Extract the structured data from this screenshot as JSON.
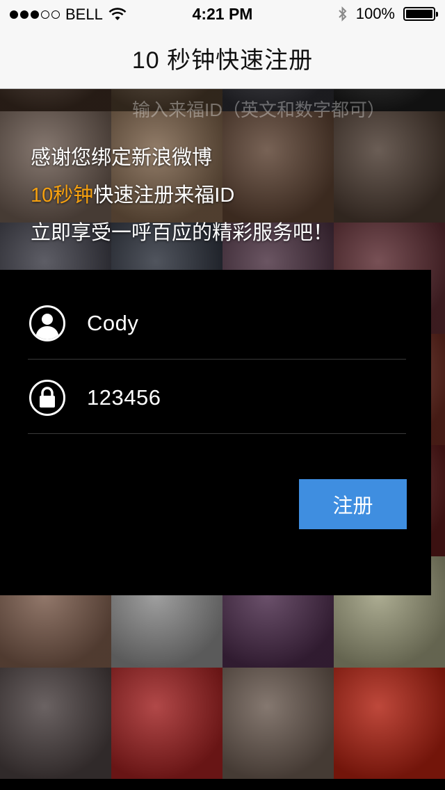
{
  "status_bar": {
    "carrier": "BELL",
    "time": "4:21 PM",
    "battery": "100%",
    "battery_level": 1.0,
    "signal_bars": 3
  },
  "nav": {
    "title": "10 秒钟快速注册"
  },
  "background_hint": "输入来福ID（英文和数字都可）",
  "intro": {
    "line1": "感谢您绑定新浪微博",
    "line2_accent": "10秒钟",
    "line2_rest": "快速注册来福ID",
    "line3": "立即享受一呼百应的精彩服务吧！"
  },
  "form": {
    "username": {
      "value": "Cody",
      "icon": "user-icon"
    },
    "password": {
      "value": "123456",
      "icon": "lock-icon"
    },
    "submit_label": "注册"
  },
  "colors": {
    "accent": "#f5a00f",
    "button": "#3f8ee0",
    "panel": "#000000"
  },
  "mosaic_tiles": [
    "#3a2a20",
    "#4a3a2a",
    "#2a2a30",
    "#1a1a1a",
    "#6b5a50",
    "#7a6048",
    "#5a4030",
    "#4a3a30",
    "#3a3a44",
    "#2a2f3a",
    "#4a3040",
    "#5a2a30",
    "#3a3a3a",
    "#2a2a2a",
    "#3a2a30",
    "#6a2a20",
    "#2a2a2a",
    "#2a2a2a",
    "#2a2a2a",
    "#5a1a1a",
    "#7a5a4a",
    "#8a8a8a",
    "#4a2a4a",
    "#9a9a7a",
    "#4a4040",
    "#a02020",
    "#6a5a50",
    "#b02010"
  ]
}
